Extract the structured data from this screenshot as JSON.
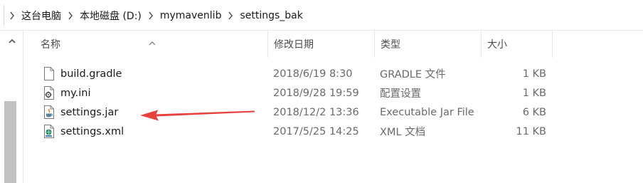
{
  "address": {
    "breadcrumbs": [
      "这台电脑",
      "本地磁盘 (D:)",
      "mymavenlib",
      "settings_bak"
    ]
  },
  "columns": {
    "name": "名称",
    "modified": "修改日期",
    "type": "类型",
    "size": "大小"
  },
  "files": [
    {
      "name": "build.gradle",
      "modified": "2018/6/19 8:30",
      "type": "GRADLE 文件",
      "size": "1 KB",
      "icon": "blank-document-icon"
    },
    {
      "name": "my.ini",
      "modified": "2018/9/28 19:59",
      "type": "配置设置",
      "size": "1 KB",
      "icon": "settings-file-icon"
    },
    {
      "name": "settings.jar",
      "modified": "2018/12/2 13:36",
      "type": "Executable Jar File",
      "size": "6 KB",
      "icon": "java-jar-icon"
    },
    {
      "name": "settings.xml",
      "modified": "2017/5/25 14:25",
      "type": "XML 文档",
      "size": "11 KB",
      "icon": "xml-document-icon"
    }
  ],
  "annotation": {
    "color": "#e8403a",
    "icon": "red-pointer-arrow"
  }
}
